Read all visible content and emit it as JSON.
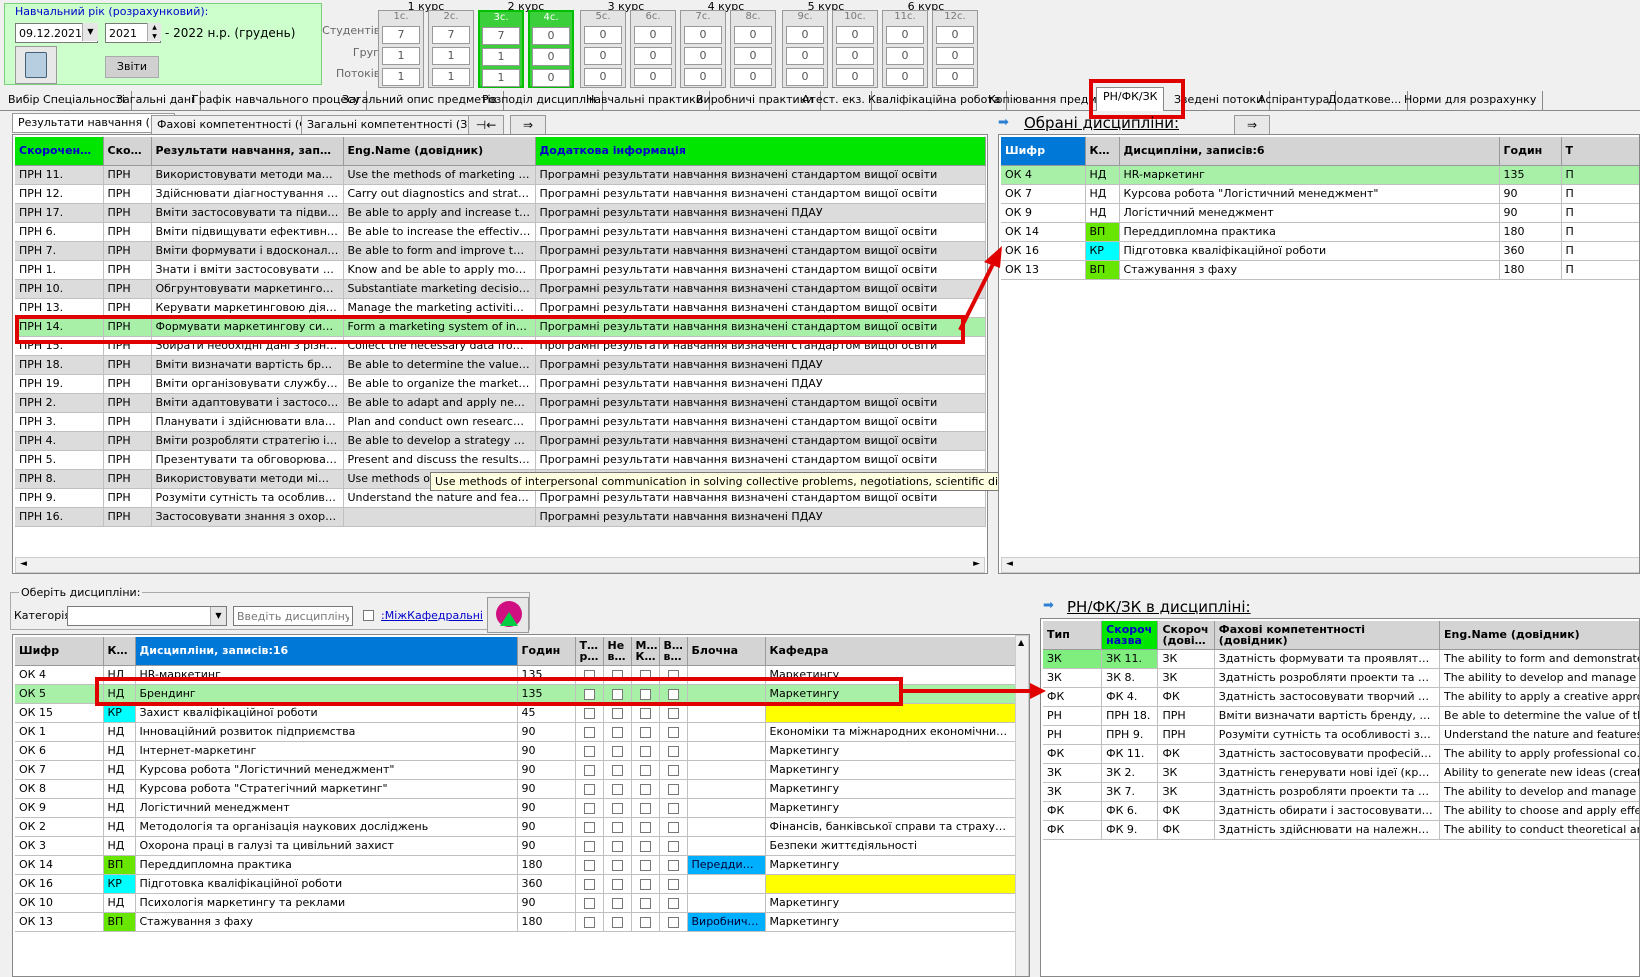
{
  "year": {
    "label": "Навчальний рік (розрахунковий):",
    "date": "09.12.2021",
    "year": "2021",
    "range_text": "- 2022 н.р. (грудень)",
    "reports_label": "Звіти"
  },
  "courses": {
    "row_labels": [
      "Студентів:",
      "Груп:",
      "Потоків:"
    ],
    "groups": [
      "1 курс",
      "2 курс",
      "3 курс",
      "4 курс",
      "5 курс",
      "6 курс"
    ],
    "columns": [
      {
        "head": "1с.",
        "values": [
          "7",
          "1",
          "1"
        ]
      },
      {
        "head": "2с.",
        "values": [
          "7",
          "1",
          "1"
        ]
      },
      {
        "head": "3с.",
        "values": [
          "7",
          "1",
          "1"
        ]
      },
      {
        "head": "4с.",
        "values": [
          "0",
          "0",
          "0"
        ]
      },
      {
        "head": "5с.",
        "values": [
          "0",
          "0",
          "0"
        ]
      },
      {
        "head": "6с.",
        "values": [
          "0",
          "0",
          "0"
        ]
      },
      {
        "head": "7с.",
        "values": [
          "0",
          "0",
          "0"
        ]
      },
      {
        "head": "8с.",
        "values": [
          "0",
          "0",
          "0"
        ]
      },
      {
        "head": "9с.",
        "values": [
          "0",
          "0",
          "0"
        ]
      },
      {
        "head": "10с.",
        "values": [
          "0",
          "0",
          "0"
        ]
      },
      {
        "head": "11с.",
        "values": [
          "0",
          "0",
          "0"
        ]
      },
      {
        "head": "12с.",
        "values": [
          "0",
          "0",
          "0"
        ]
      }
    ]
  },
  "tabs": [
    "Вибір Спеціальності",
    "Загальні дані",
    "Графік навчального процесу",
    "Загальний опис предметів",
    "Розподіл дисциплін",
    "Навчальні практики",
    "Виробничі практики",
    "Атест. екз.",
    "Кваліфікаційна робота",
    "Копіювання предметі",
    "РН/ФК/ЗК",
    "Зведені потоки",
    "Аспірантура",
    "Додаткове...",
    "Норми для розрахунку"
  ],
  "subtabs": [
    "Результати навчання (РН)",
    "Фахові компетентності (ФК)",
    "Загальні компетентності (ЗК)"
  ],
  "rn_table": {
    "headers": [
      "Скорочена назва",
      "Скороч (довідн",
      "Результати навчання, записів:19",
      "Eng.Name (довідник)",
      "Додаткова інформація"
    ],
    "rows": [
      [
        "ПРН 11.",
        "ПРН",
        "Використовувати методи маркетин...",
        "Use the methods of marketing strategi...",
        "Програмні результати навчання визначені стандартом вищої освіти"
      ],
      [
        "ПРН 12.",
        "ПРН",
        "Здійснювати діагностування та стр...",
        "Carry out diagnostics and strategic and...",
        "Програмні результати навчання визначені стандартом вищої освіти"
      ],
      [
        "ПРН 17.",
        "ПРН",
        "Вміти застосовувати та підвищуват...",
        "Be able to apply and increase the effe...",
        "Програмні результати навчання визначені ПДАУ"
      ],
      [
        "ПРН 6.",
        "ПРН",
        "Вміти підвищувати ефективність ма...",
        "Be able to increase the effectiveness ...",
        "Програмні результати навчання визначені стандартом вищої освіти"
      ],
      [
        "ПРН 7.",
        "ПРН",
        "Вміти формувати і вдосконалювати ...",
        "Be able to form and improve the marke...",
        "Програмні результати навчання визначені стандартом вищої освіти"
      ],
      [
        "ПРН 1.",
        "ПРН",
        "Знати і вміти застосовувати у практ...",
        "Know and be able to apply modern pri...",
        "Програмні результати навчання визначені стандартом вищої освіти"
      ],
      [
        "ПРН 10.",
        "ПРН",
        "Обгрунтовувати маркетингові рішен...",
        "Substantiate marketing decisions at th...",
        "Програмні результати навчання визначені стандартом вищої освіти"
      ],
      [
        "ПРН 13.",
        "ПРН",
        "Керувати маркетинговою діяльніст...",
        "Manage the marketing activities of the...",
        "Програмні результати навчання визначені стандартом вищої освіти"
      ],
      [
        "ПРН 14.",
        "ПРН",
        "Формувати маркетингову систему ...",
        "Form a marketing system of interaction,...",
        "Програмні результати навчання визначені стандартом вищої освіти"
      ],
      [
        "ПРН 15.",
        "ПРН",
        "Збирати необхідні дані з різних дже...",
        "Collect the necessary data from vario...",
        "Програмні результати навчання визначені стандартом вищої освіти"
      ],
      [
        "ПРН 18.",
        "ПРН",
        "Вміти визначати вартість бренду, е...",
        "Be able to determine the value of the b...",
        "Програмні результати навчання визначені ПДАУ"
      ],
      [
        "ПРН 19.",
        "ПРН",
        "Вміти організовувати службу марке...",
        "Be able to organize the marketing servi...",
        "Програмні результати навчання визначені ПДАУ"
      ],
      [
        "ПРН 2.",
        "ПРН",
        "Вміти адаптовувати і застосовувати...",
        "Be able to adapt and apply new advan...",
        "Програмні результати навчання визначені стандартом вищої освіти"
      ],
      [
        "ПРН 3.",
        "ПРН",
        "Планувати і здійснювати власні дос...",
        "Plan and conduct own research in the ...",
        "Програмні результати навчання визначені стандартом вищої освіти"
      ],
      [
        "ПРН 4.",
        "ПРН",
        "Вміти розробляти стратегію і такти...",
        "Be able to develop a strategy and tacti...",
        "Програмні результати навчання визначені стандартом вищої освіти"
      ],
      [
        "ПРН 5.",
        "ПРН",
        "Презентувати та обговорювати рез...",
        "Present and discuss the results of scie...",
        "Програмні результати навчання визначені стандартом вищої освіти"
      ],
      [
        "ПРН 8.",
        "ПРН",
        "Використовувати методи міжособи...",
        "Use methods of int",
        "Програмні результати навчання визначені стандартом вищої освіти"
      ],
      [
        "ПРН 9.",
        "ПРН",
        "Розуміти сутність та особливості за...",
        "Understand the nature and features of ...",
        "Програмні результати навчання визначені стандартом вищої освіти"
      ],
      [
        "ПРН 16.",
        "ПРН",
        "Застосовувати знання з охорони пр...",
        "",
        "Програмні результати навчання визначені ПДАУ"
      ]
    ],
    "selected_index": 8
  },
  "tooltip": "Use methods of interpersonal communication in solving collective problems, negotiations, scientific discussions in the field of marketing.",
  "selected_disc": {
    "title": "Обрані дисципліни:",
    "headers": [
      "Шифр",
      "Кате",
      "Дисципліни, записів:6",
      "Годин",
      "Т"
    ],
    "rows": [
      {
        "code": "ОК 4",
        "cat": "НД",
        "name": "HR-маркетинг",
        "hours": "135",
        "t": "П",
        "sel": true
      },
      {
        "code": "ОК 7",
        "cat": "НД",
        "name": "Курсова робота \"Логістичний менеджмент\"",
        "hours": "90",
        "t": "П"
      },
      {
        "code": "ОК 9",
        "cat": "НД",
        "name": "Логістичний менеджмент",
        "hours": "90",
        "t": "П"
      },
      {
        "code": "ОК 14",
        "cat": "ВП",
        "name": "Переддипломна практика",
        "hours": "180",
        "t": "П"
      },
      {
        "code": "ОК 16",
        "cat": "КР",
        "name": "Підготовка кваліфікаційної роботи",
        "hours": "360",
        "t": "П"
      },
      {
        "code": "ОК 13",
        "cat": "ВП",
        "name": "Стажування з фаху",
        "hours": "180",
        "t": "П"
      }
    ]
  },
  "filter": {
    "group_label": "Оберіть дисципліни:",
    "category_label": "Категорія:",
    "search_placeholder": "Введіть дисципліну",
    "interdept_label": ":МіжКафедральні"
  },
  "disc_table": {
    "headers": [
      "Шифр",
      "Кате",
      "Дисципліни, записів:16",
      "Годин",
      "Тіл роз",
      "Не виб",
      "Між Каф",
      "Вра вНГ",
      "Блочна",
      "Кафедра"
    ],
    "rows": [
      {
        "code": "ОК 4",
        "cat": "НД",
        "name": "HR-маркетинг",
        "hours": "135",
        "block": "",
        "dept": "Маркетингу"
      },
      {
        "code": "ОК 5",
        "cat": "НД",
        "name": "Брендинг",
        "hours": "135",
        "block": "",
        "dept": "Маркетингу",
        "sel": true
      },
      {
        "code": "ОК 15",
        "cat": "КР",
        "name": "Захист кваліфікаційної роботи",
        "hours": "45",
        "block": "",
        "dept": "",
        "yel": true
      },
      {
        "code": "ОК 1",
        "cat": "НД",
        "name": "Інноваційний розвиток підприємства",
        "hours": "90",
        "block": "",
        "dept": "Економіки та міжнародних економічних відносин"
      },
      {
        "code": "ОК 6",
        "cat": "НД",
        "name": "Інтернет-маркетинг",
        "hours": "90",
        "block": "",
        "dept": "Маркетингу"
      },
      {
        "code": "ОК 7",
        "cat": "НД",
        "name": "Курсова робота \"Логістичний менеджмент\"",
        "hours": "90",
        "block": "",
        "dept": "Маркетингу"
      },
      {
        "code": "ОК 8",
        "cat": "НД",
        "name": "Курсова робота \"Стратегічний маркетинг\"",
        "hours": "90",
        "block": "",
        "dept": "Маркетингу"
      },
      {
        "code": "ОК 9",
        "cat": "НД",
        "name": "Логістичний менеджмент",
        "hours": "90",
        "block": "",
        "dept": "Маркетингу"
      },
      {
        "code": "ОК 2",
        "cat": "НД",
        "name": "Методологія та організація наукових досліджень",
        "hours": "90",
        "block": "",
        "dept": "Фінансів, банківської справи та страхування"
      },
      {
        "code": "ОК 3",
        "cat": "НД",
        "name": "Охорона праці в галузі та цивільний захист",
        "hours": "90",
        "block": "",
        "dept": "Безпеки життєдіяльності"
      },
      {
        "code": "ОК 14",
        "cat": "ВП",
        "name": "Переддипломна практика",
        "hours": "180",
        "block": "Переддипло...",
        "dept": "Маркетингу"
      },
      {
        "code": "ОК 16",
        "cat": "КР",
        "name": "Підготовка кваліфікаційної роботи",
        "hours": "360",
        "block": "",
        "dept": "",
        "yel": true
      },
      {
        "code": "ОК 10",
        "cat": "НД",
        "name": "Психологія маркетингу та реклами",
        "hours": "90",
        "block": "",
        "dept": "Маркетингу"
      },
      {
        "code": "ОК 13",
        "cat": "ВП",
        "name": "Стажування з фаху",
        "hours": "180",
        "block": "Виробнича п...",
        "dept": "Маркетингу"
      }
    ]
  },
  "comp_panel": {
    "title": "РН/ФК/ЗК в дисципліні:",
    "headers": [
      "Тип",
      "Скороч назва",
      "Скороч (довідн",
      "Фахові компетентності (довідник)",
      "Eng.Name (довідник)"
    ],
    "rows": [
      [
        "ЗК",
        "ЗК 11.",
        "ЗК",
        "Здатність формувати та проявляти ...",
        "The ability to form and demonstrate lea..."
      ],
      [
        "ЗК",
        "ЗК 8.",
        "ЗК",
        "Здатність розробляти проекти та уп...",
        "The ability to develop and manage proj..."
      ],
      [
        "ФК",
        "ФК 4.",
        "ФК",
        "Здатність застосовувати творчий пі...",
        "The ability to apply a creative approac..."
      ],
      [
        "РН",
        "ПРН 18.",
        "ПРН",
        "Вміти визначати вартість бренду, е...",
        "Be able to determine the value of the b..."
      ],
      [
        "РН",
        "ПРН 9.",
        "ПРН",
        "Розуміти сутність та особливості за...",
        "Understand the nature and features of ..."
      ],
      [
        "ФК",
        "ФК 11.",
        "ФК",
        "Здатність застосовувати професійн...",
        "The ability to apply professional compe..."
      ],
      [
        "ЗК",
        "ЗК 2.",
        "ЗК",
        "Здатність генерувати нові ідеї (креа...",
        "Ability to generate new ideas (creativity)."
      ],
      [
        "ЗК",
        "ЗК 7.",
        "ЗК",
        "Здатність розробляти проекти та уп...",
        "The ability to develop and manage proj..."
      ],
      [
        "ФК",
        "ФК 6.",
        "ФК",
        "Здатність обирати і застосовувати ...",
        "The ability to choose and apply effecti..."
      ],
      [
        "ФК",
        "ФК 9.",
        "ФК",
        "Здатність здійснювати на належно...",
        "The ability to conduct theoretical and ..."
      ]
    ]
  },
  "colors": {
    "accent_green": "#00e600",
    "highlight_red": "#e00000",
    "selection_green": "#a8f0a8",
    "header_blue": "#0078d7"
  }
}
